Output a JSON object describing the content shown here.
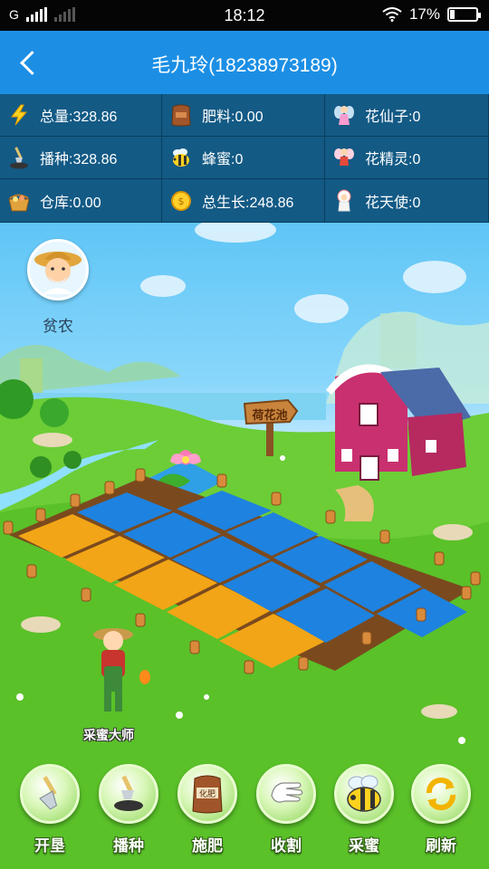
{
  "status_bar": {
    "carrier": "G",
    "time": "18:12",
    "battery_percent": "17%",
    "battery_level": 0.17
  },
  "header": {
    "title": "毛九玲(18238973189)"
  },
  "stats": [
    {
      "icon": "lightning-icon",
      "text": "总量:328.86"
    },
    {
      "icon": "fertilizer-bag-icon",
      "text": "肥料:0.00"
    },
    {
      "icon": "flower-fairy-icon",
      "text": "花仙子:0"
    },
    {
      "icon": "shovel-seed-icon",
      "text": "播种:328.86"
    },
    {
      "icon": "bee-icon",
      "text": "蜂蜜:0"
    },
    {
      "icon": "flower-sprite-icon",
      "text": "花精灵:0"
    },
    {
      "icon": "warehouse-basket-icon",
      "text": "仓库:0.00"
    },
    {
      "icon": "coin-icon",
      "text": "总生长:248.86"
    },
    {
      "icon": "flower-angel-icon",
      "text": "花天使:0"
    }
  ],
  "scene": {
    "avatar_label": "贫农",
    "pond_sign": "荷花池",
    "farmer_label": "采蜜大师",
    "fertilizer_bag_text": "化肥"
  },
  "actions": [
    {
      "icon": "shovel-icon",
      "label": "开垦"
    },
    {
      "icon": "seed-shovel-icon",
      "label": "播种"
    },
    {
      "icon": "fertilizer-icon",
      "label": "施肥"
    },
    {
      "icon": "glove-icon",
      "label": "收割"
    },
    {
      "icon": "bee-icon",
      "label": "采蜜"
    },
    {
      "icon": "refresh-icon",
      "label": "刷新"
    }
  ]
}
